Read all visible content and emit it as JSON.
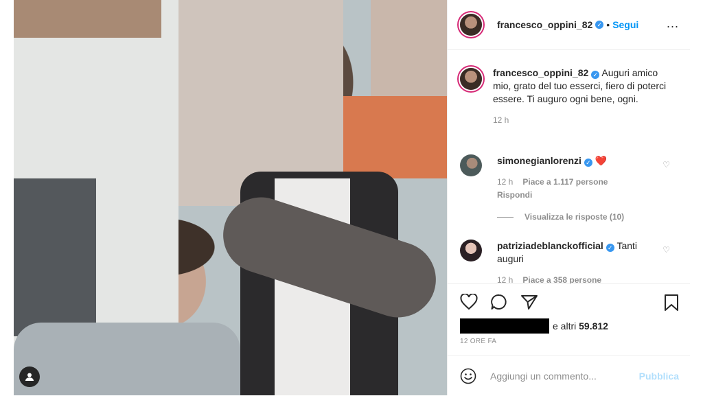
{
  "post": {
    "author": "francesco_oppini_82",
    "verified": true,
    "separator": "•",
    "follow_label": "Segui",
    "more_label": "..."
  },
  "caption": {
    "author": "francesco_oppini_82",
    "text": "Auguri amico mio, grato del tuo esserci, fiero di poterci essere. Ti auguro ogni bene, ogni.",
    "time": "12 h"
  },
  "comments": [
    {
      "user": "simonegianlorenzi",
      "verified": true,
      "text": "❤️",
      "time": "12 h",
      "likes": "Piace a 1.117 persone",
      "reply": "Rispondi",
      "view_replies": "Visualizza le risposte (10)"
    },
    {
      "user": "patriziadeblanckofficial",
      "verified": true,
      "text": "Tanti auguri",
      "time": "12 h",
      "likes": "Piace a 358 persone"
    }
  ],
  "engagement": {
    "likes_prefix": "e altri",
    "likes_count": "59.812",
    "time_ago": "12 ORE FA"
  },
  "composer": {
    "placeholder": "Aggiungi un commento...",
    "publish_label": "Pubblica"
  },
  "icons": {
    "like": "heart-icon",
    "comment": "comment-icon",
    "share": "share-icon",
    "save": "bookmark-icon",
    "emoji": "emoji-icon",
    "user_tag": "user-tag-icon"
  },
  "colors": {
    "link_blue": "#0095f6",
    "verified_blue": "#3897f0",
    "muted": "#8e8e8e",
    "publish_disabled": "#b2dffc"
  }
}
